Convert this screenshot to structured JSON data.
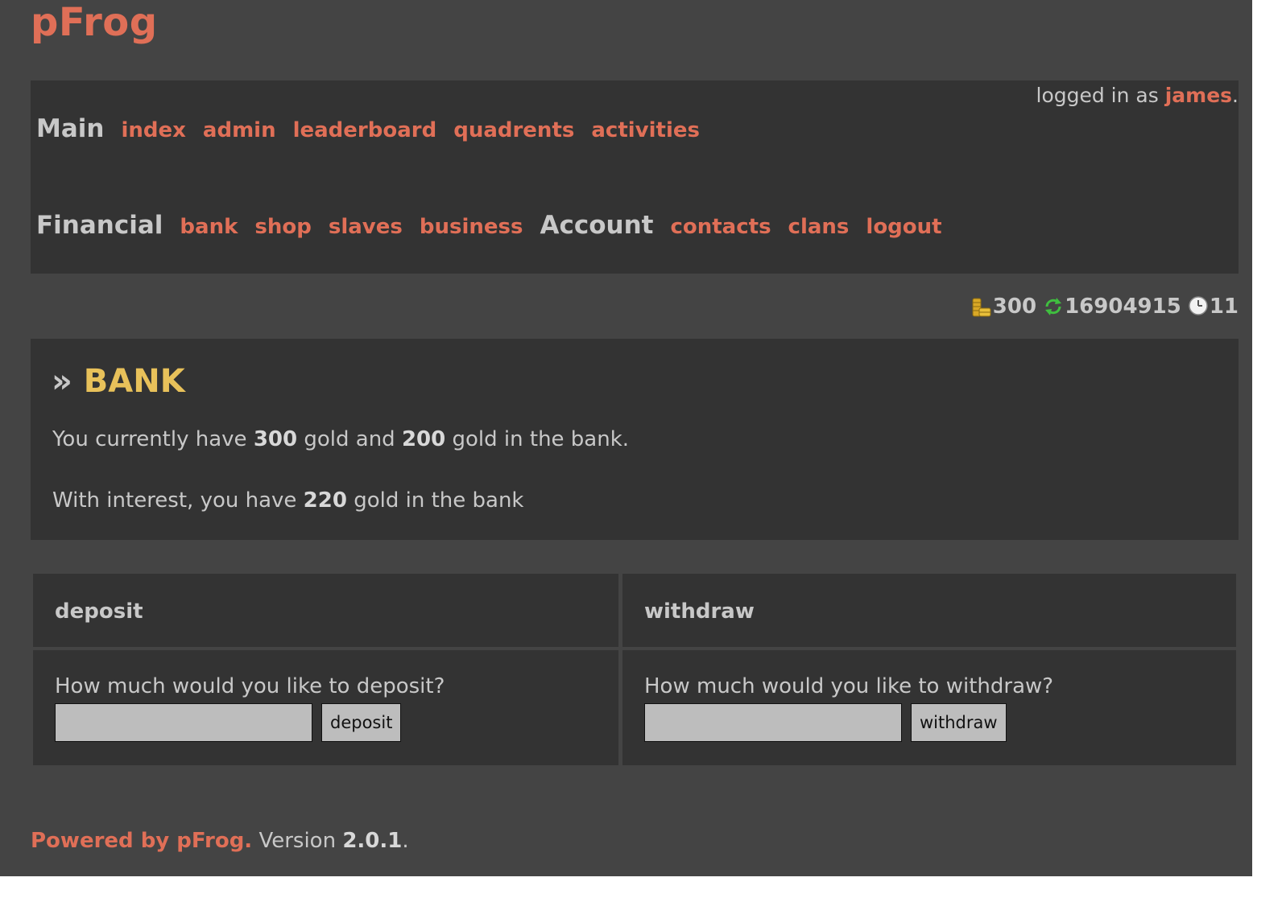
{
  "app": {
    "logo": "pFrog"
  },
  "login": {
    "prefix": "logged in as ",
    "user": "james",
    "suffix": "."
  },
  "nav": {
    "main": {
      "heading": "Main",
      "links": [
        "index",
        "admin",
        "leaderboard",
        "quadrents",
        "activities"
      ]
    },
    "financial": {
      "heading": "Financial",
      "links": [
        "bank",
        "shop",
        "slaves",
        "business"
      ]
    },
    "account": {
      "heading": "Account",
      "links": [
        "contacts",
        "clans",
        "logout"
      ]
    }
  },
  "stats": {
    "gold": "300",
    "turns": "16904915",
    "time": "11",
    "icons": [
      "coins-icon",
      "refresh-icon",
      "clock-icon"
    ]
  },
  "bank": {
    "arrow": "»",
    "title": "BANK",
    "line1": {
      "a": "You currently have ",
      "gold": "300",
      "b": " gold and ",
      "bank_gold": "200",
      "c": " gold in the bank."
    },
    "line2": {
      "a": "With interest, you have ",
      "interest_gold": "220",
      "b": " gold in the bank"
    }
  },
  "deposit": {
    "header": "deposit",
    "question": "How much would you like to deposit?",
    "value": "",
    "button": "deposit"
  },
  "withdraw": {
    "header": "withdraw",
    "question": "How much would you like to withdraw?",
    "value": "",
    "button": "withdraw"
  },
  "footer": {
    "powered": "Powered by pFrog.",
    "version_label": " Version ",
    "version": "2.0.1",
    "end": "."
  },
  "colors": {
    "page_bg": "#444444",
    "panel_bg": "#333333",
    "accent": "#e06f57",
    "title": "#e8c15a",
    "text": "#c8c8c8",
    "input_bg": "#bdbdbd"
  }
}
